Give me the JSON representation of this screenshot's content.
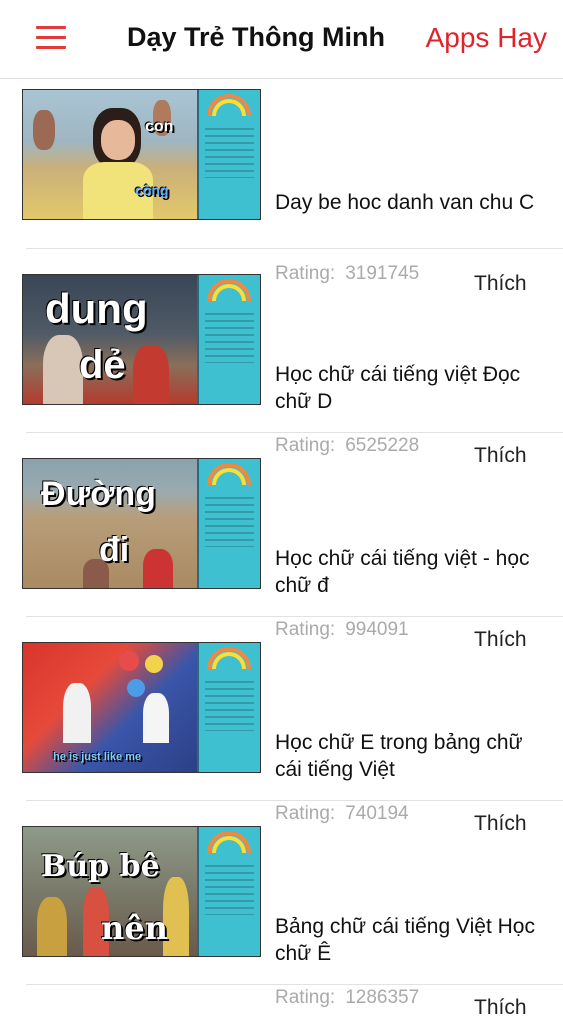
{
  "header": {
    "menu_icon": "hamburger-icon",
    "title": "Dạy Trẻ Thông Minh",
    "apps_link": "Apps Hay",
    "accent": "#e0232b"
  },
  "videos": [
    {
      "title": "Day be hoc danh van chu C",
      "rating_label": "Rating:",
      "rating": "3191745",
      "like": "Thích",
      "overlay": [
        "con",
        "công"
      ]
    },
    {
      "title": "Học chữ cái tiếng việt Đọc chữ D",
      "rating_label": "Rating:",
      "rating": "6525228",
      "like": "Thích",
      "overlay": [
        "dung",
        "dẻ"
      ]
    },
    {
      "title": "Học chữ cái tiếng việt - học chữ đ",
      "rating_label": "Rating:",
      "rating": "994091",
      "like": "Thích",
      "overlay": [
        "Đường",
        "đi"
      ]
    },
    {
      "title": "Học chữ E trong bảng chữ cái tiếng Việt",
      "rating_label": "Rating:",
      "rating": "740194",
      "like": "Thích",
      "overlay": [
        "he is just like me"
      ]
    },
    {
      "title": "Bảng chữ cái tiếng Việt Học chữ Ê",
      "rating_label": "Rating:",
      "rating": "1286357",
      "like": "Thích",
      "overlay": [
        "Búp bê",
        "nên"
      ]
    }
  ]
}
